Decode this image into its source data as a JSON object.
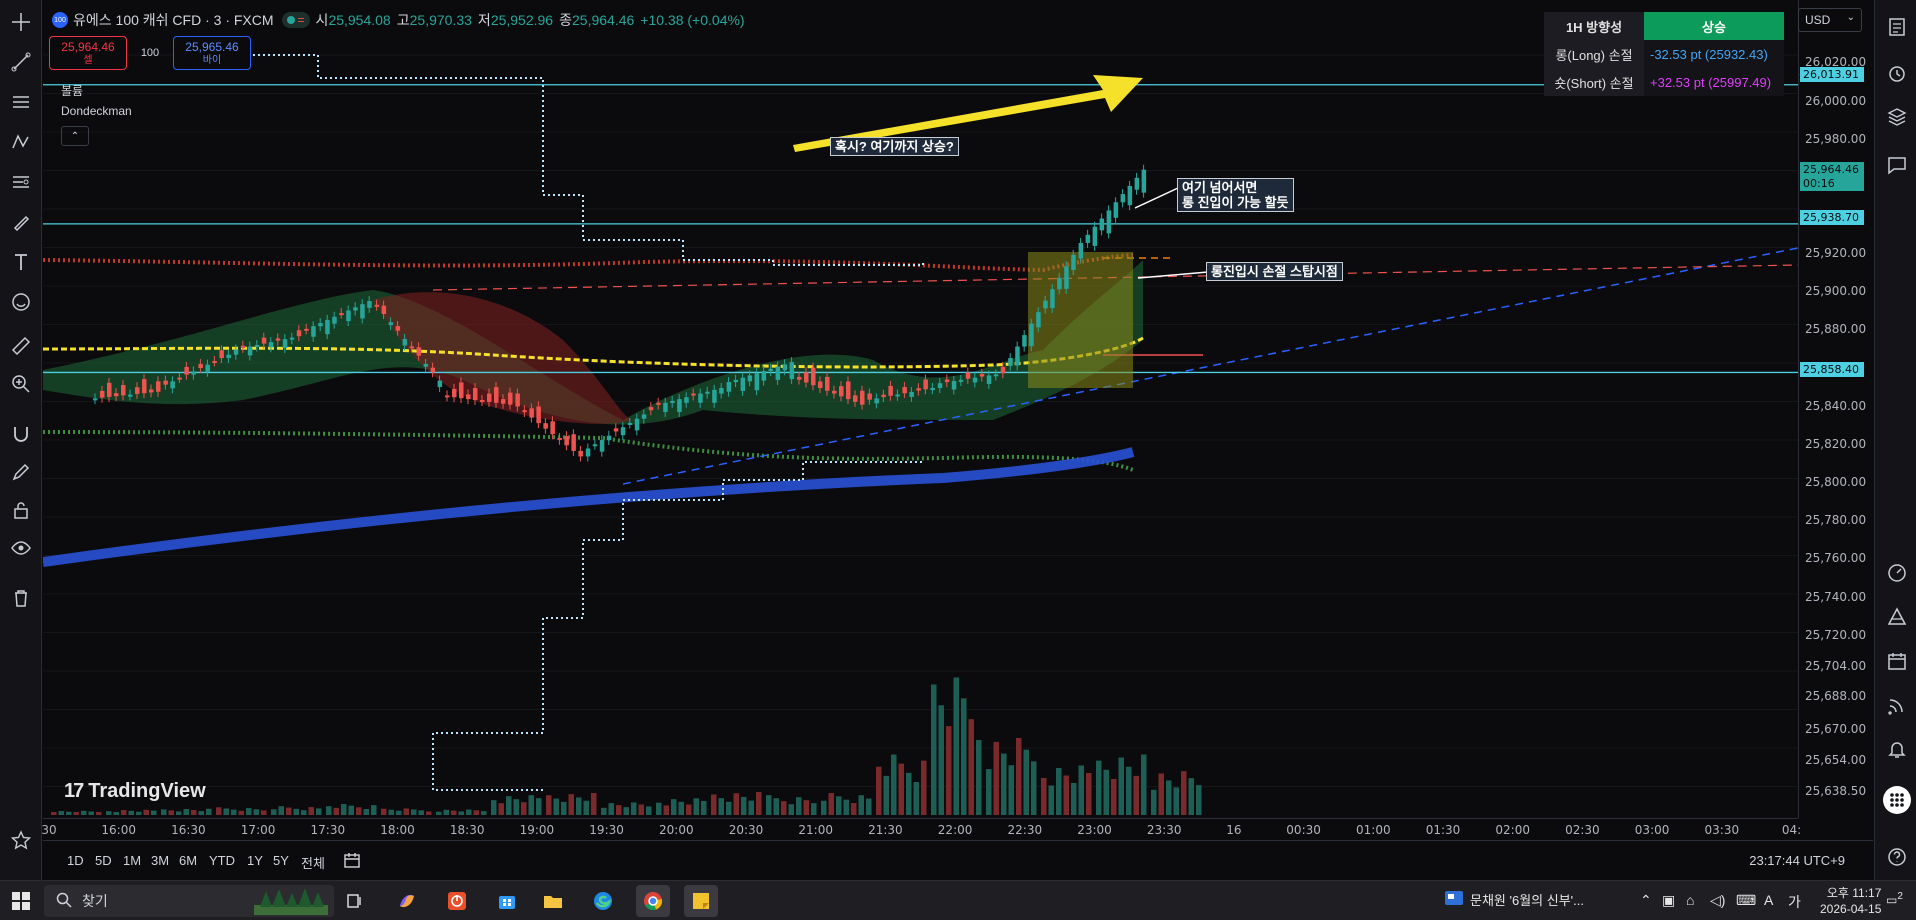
{
  "header": {
    "symbol_badge": "100",
    "symbol_title": "유에스 100 캐쉬 CFD · 3 · FXCM",
    "ohlc": [
      {
        "key": "시",
        "value": "25,954.08"
      },
      {
        "key": "고",
        "value": "25,970.33"
      },
      {
        "key": "저",
        "value": "25,952.96"
      },
      {
        "key": "종",
        "value": "25,964.46"
      }
    ],
    "change": "+10.38 (+0.04%)",
    "status_eq": "="
  },
  "trade": {
    "sell_price": "25,964.46",
    "sell_label": "셀",
    "spread": "100",
    "buy_price": "25,965.46",
    "buy_label": "바이"
  },
  "indicators": {
    "volume_label": "볼륨",
    "custom_label": "Dondeckman",
    "collapse_glyph": "⌃"
  },
  "direction_table": {
    "header_key": "1H 방향성",
    "header_value": "상승",
    "long_key": "롱(Long) 손절",
    "long_value": "-32.53 pt (25932.43)",
    "short_key": "숏(Short) 손절",
    "short_value": "+32.53 pt (25997.49)"
  },
  "currency": {
    "selected": "USD"
  },
  "price_axis": {
    "ticks": [
      "26,020.00",
      "26,000.00",
      "25,980.00",
      "25,920.00",
      "25,900.00",
      "25,880.00",
      "25,840.00",
      "25,820.00",
      "25,800.00",
      "25,780.00",
      "25,760.00",
      "25,740.00",
      "25,720.00",
      "25,704.00",
      "25,688.00",
      "25,670.00",
      "25,654.00",
      "25,638.50"
    ],
    "labels": {
      "level_top": "26,013.91",
      "current_price": "25,964.46",
      "countdown": "00:16",
      "level_mid": "25,938.70",
      "level_low": "25,858.40"
    }
  },
  "time_axis": {
    "ticks": [
      "30",
      "16:00",
      "16:30",
      "17:00",
      "17:30",
      "18:00",
      "18:30",
      "19:00",
      "19:30",
      "20:00",
      "20:30",
      "21:00",
      "21:30",
      "22:00",
      "22:30",
      "23:00",
      "23:30",
      "16",
      "00:30",
      "01:00",
      "01:30",
      "02:00",
      "02:30",
      "03:00",
      "03:30",
      "04:"
    ]
  },
  "range_bar": {
    "buttons": [
      "1D",
      "5D",
      "1M",
      "3M",
      "6M",
      "YTD",
      "1Y",
      "5Y",
      "전체"
    ],
    "clock": "23:17:44 UTC+9"
  },
  "annotations": {
    "rise_question": "혹시? 여기까지 상승?",
    "long_entry_line1": "여기 넘어서면",
    "long_entry_line2": "롱 진입이 가능 할듯",
    "stop_loss": "롱진입시 손절 스탑시점"
  },
  "logo": {
    "text": "TradingView",
    "mark": "17"
  },
  "taskbar": {
    "search_placeholder": "찾기",
    "news_text": "문채원 '6월의 신부'...",
    "time": "오후 11:17",
    "date": "2026-04-15",
    "notification_count": "2"
  },
  "colors": {
    "bull": "#26a69a",
    "bear": "#ef5350",
    "level_line": "#4dd0e1",
    "trend_blue": "#2962ff",
    "yellow_ma": "#f5e12a",
    "direction_up": "#0c9b5a"
  },
  "chart_data": {
    "type": "line",
    "x": [
      "16:00",
      "16:30",
      "17:00",
      "17:30",
      "18:00",
      "18:30",
      "19:00",
      "19:30",
      "20:00",
      "20:30",
      "21:00",
      "21:30",
      "22:00",
      "22:30",
      "23:00",
      "23:15"
    ],
    "series": [
      {
        "values": [
          25848,
          25852,
          25870,
          25878,
          25895,
          25850,
          25845,
          25815,
          25838,
          25848,
          25860,
          25845,
          25852,
          25858,
          25920,
          25964
        ]
      }
    ],
    "ylim": [
      25630,
      26030
    ],
    "horizontal_levels": [
      26013.91,
      25938.7,
      25858.4
    ],
    "volume_values": [
      4,
      5,
      6,
      7,
      8,
      10,
      6,
      5,
      18,
      20,
      12,
      16,
      22,
      18,
      20,
      55,
      125,
      70,
      45,
      55,
      42
    ]
  }
}
